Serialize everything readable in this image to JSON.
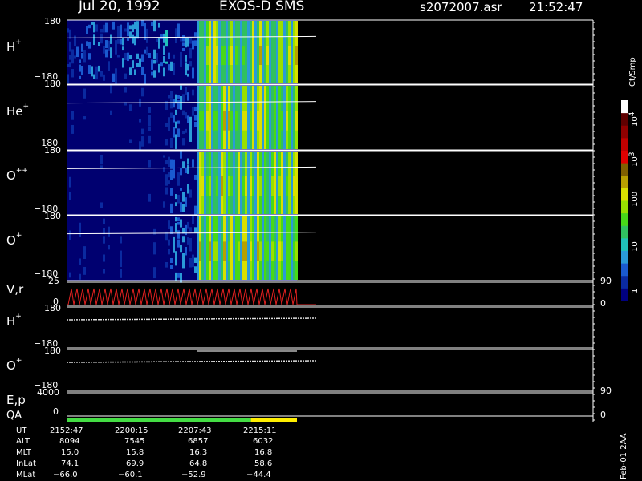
{
  "header": {
    "date": "Jul 20, 1992",
    "instrument": "EXOS-D SMS",
    "filename": "s2072007.asr",
    "time": "21:52:47"
  },
  "panels": [
    {
      "species": "H",
      "charge": "+",
      "ymax": "180",
      "ymin": "−180"
    },
    {
      "species": "He",
      "charge": "+",
      "ymax": "180",
      "ymin": "−180"
    },
    {
      "species": "O",
      "charge": "++",
      "ymax": "180",
      "ymin": "−180"
    },
    {
      "species": "O",
      "charge": "+",
      "ymax": "180",
      "ymin": "−180"
    }
  ],
  "lower_panels": {
    "vr": {
      "label": "V,r",
      "ymax": "25",
      "ymin": "0",
      "right_max": "90",
      "right_min": "0"
    },
    "h_plus": {
      "species": "H",
      "charge": "+",
      "ymax": "180",
      "ymin": "−180"
    },
    "o_plus": {
      "species": "O",
      "charge": "+",
      "ymax": "180",
      "ymin": "−180"
    },
    "ep": {
      "label": "E,p",
      "ymax": "4000",
      "ymin": "0",
      "right_max": "90",
      "right_min": "0"
    },
    "qa": {
      "label": "QA"
    }
  },
  "colorbar": {
    "unit": "Ct/Smp",
    "ticks": [
      {
        "base": "10",
        "exp": "4"
      },
      {
        "base": "10",
        "exp": "3"
      },
      {
        "base": "100",
        "exp": ""
      },
      {
        "base": "10",
        "exp": ""
      },
      {
        "base": "1",
        "exp": ""
      }
    ],
    "colors": [
      "#000080",
      "#0a2aa0",
      "#1a5ad0",
      "#2a9ad8",
      "#20c0b8",
      "#30c060",
      "#48d818",
      "#98e000",
      "#d8e000",
      "#b8a000",
      "#806000",
      "#e00000",
      "#c00000",
      "#900000",
      "#600000",
      "#ffffff"
    ]
  },
  "orbit": {
    "row_labels": [
      "UT",
      "ALT",
      "MLT",
      "InLat",
      "MLat"
    ],
    "columns": [
      [
        "2152:47",
        "8094",
        "15.0",
        "74.1",
        "−66.0"
      ],
      [
        "2200:15",
        "7545",
        "15.8",
        "69.9",
        "−60.1"
      ],
      [
        "2207:43",
        "6857",
        "16.3",
        "64.8",
        "−52.9"
      ],
      [
        "2215:11",
        "6032",
        "16.8",
        "58.6",
        "−44.4"
      ]
    ]
  },
  "footer_stamp": "Feb-01 2AA",
  "chart_data": {
    "type": "heatmap",
    "title": "Jul 20, 1992    EXOS-D SMS",
    "x": [
      "2152:47",
      "2200:15",
      "2207:43",
      "2215:11"
    ],
    "series": [
      {
        "name": "H+",
        "ylim": [
          -180,
          180
        ]
      },
      {
        "name": "He+",
        "ylim": [
          -180,
          180
        ]
      },
      {
        "name": "O++",
        "ylim": [
          -180,
          180
        ]
      },
      {
        "name": "O+",
        "ylim": [
          -180,
          180
        ]
      }
    ],
    "colorbar_unit": "Ct/Smp",
    "colorbar_range": [
      1,
      10000
    ],
    "colorbar_scale": "log",
    "qa_segments": [
      {
        "status": "good",
        "color": "#44dd44",
        "fraction": 0.8
      },
      {
        "status": "warn",
        "color": "#ffee00",
        "fraction": 0.2
      }
    ]
  }
}
